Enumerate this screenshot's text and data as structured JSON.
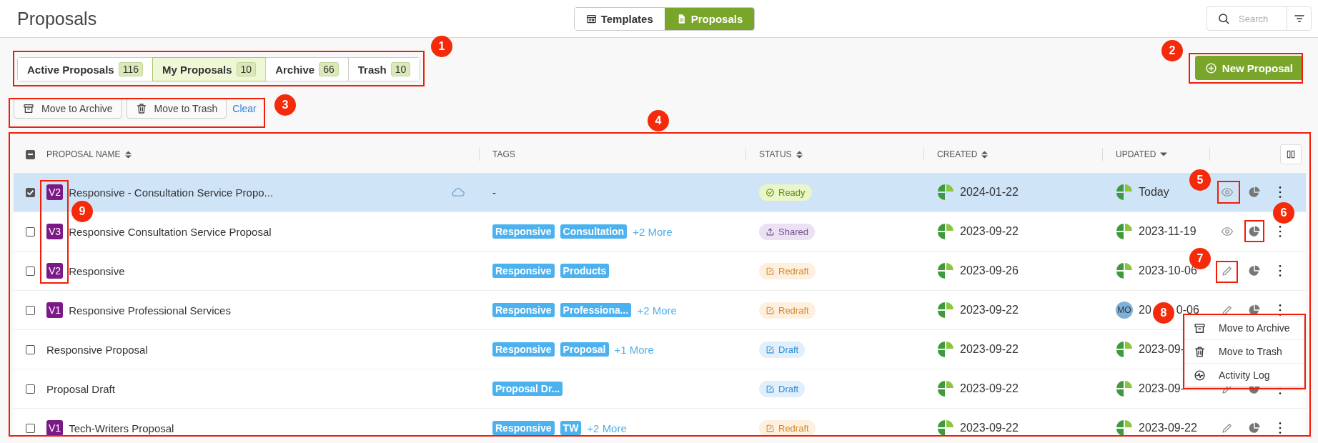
{
  "page_title": "Proposals",
  "view_switch": [
    {
      "label": "Templates",
      "selected": false
    },
    {
      "label": "Proposals",
      "selected": true
    }
  ],
  "search": {
    "placeholder": "Search"
  },
  "tabs": [
    {
      "label": "Active Proposals",
      "count": "116",
      "selected": false
    },
    {
      "label": "My Proposals",
      "count": "10",
      "selected": true
    },
    {
      "label": "Archive",
      "count": "66",
      "selected": false
    },
    {
      "label": "Trash",
      "count": "10",
      "selected": false
    }
  ],
  "new_button": "New Proposal",
  "bulk_actions": [
    {
      "label": "Move to Archive"
    },
    {
      "label": "Move to Trash"
    }
  ],
  "clear_link": "Clear",
  "table": {
    "select_all": {
      "indeterminate": true
    },
    "columns": [
      {
        "label": "PROPOSAL NAME",
        "sortable": true
      },
      {
        "label": "TAGS",
        "sortable": false
      },
      {
        "label": "STATUS",
        "sortable": true
      },
      {
        "label": "CREATED",
        "sortable": true
      },
      {
        "label": "UPDATED",
        "sortable": true,
        "sorted": true
      }
    ],
    "rows": [
      {
        "selected": true,
        "checked": true,
        "version": "V2",
        "name": "Responsive - Consultation Service Propo...",
        "cloud": true,
        "tags": [],
        "no_tags": "-",
        "status": {
          "kind": "ready",
          "label": "Ready"
        },
        "created": "2024-01-22",
        "updated": "Today",
        "updater": {
          "kind": "logo"
        },
        "action": {
          "kind": "view"
        }
      },
      {
        "selected": false,
        "checked": false,
        "version": "V3",
        "name": "Responsive Consultation Service Proposal",
        "cloud": false,
        "tags": [
          "Responsive",
          "Consultation"
        ],
        "more": "+2 More",
        "status": {
          "kind": "shared",
          "label": "Shared"
        },
        "created": "2023-09-22",
        "updated": "2023-11-19",
        "updater": {
          "kind": "logo"
        },
        "action": {
          "kind": "view"
        }
      },
      {
        "selected": false,
        "checked": false,
        "version": "V2",
        "name": "Responsive",
        "cloud": false,
        "tags": [
          "Responsive",
          "Products"
        ],
        "status": {
          "kind": "redraft",
          "label": "Redraft"
        },
        "created": "2023-09-26",
        "updated": "2023-10-06",
        "updater": {
          "kind": "logo"
        },
        "action": {
          "kind": "edit"
        }
      },
      {
        "selected": false,
        "checked": false,
        "version": "V1",
        "name": "Responsive Professional Services",
        "cloud": false,
        "tags": [
          "Responsive",
          "Professiona..."
        ],
        "more": "+2 More",
        "status": {
          "kind": "redraft",
          "label": "Redraft"
        },
        "created": "2023-09-22",
        "updated": "20",
        "updated_after_callout": "0-06",
        "updater": {
          "kind": "avatar",
          "initials": "MO"
        },
        "action": {
          "kind": "edit"
        }
      },
      {
        "selected": false,
        "checked": false,
        "name": "Responsive Proposal",
        "cloud": false,
        "tags": [
          "Responsive",
          "Proposal"
        ],
        "more": "+1 More",
        "status": {
          "kind": "draft",
          "label": "Draft"
        },
        "created": "2023-09-22",
        "updated": "2023-09-",
        "updater": {
          "kind": "logo"
        }
      },
      {
        "selected": false,
        "checked": false,
        "name": "Proposal Draft",
        "cloud": false,
        "tags": [
          "Proposal Dr..."
        ],
        "status": {
          "kind": "draft",
          "label": "Draft"
        },
        "created": "2023-09-22",
        "updated": "2023-09-",
        "updater": {
          "kind": "logo"
        },
        "action": {
          "kind": "edit"
        }
      },
      {
        "selected": false,
        "checked": false,
        "version": "V1",
        "name": "Tech-Writers Proposal",
        "cloud": false,
        "tags": [
          "Responsive",
          "TW"
        ],
        "more": "+2 More",
        "status": {
          "kind": "redraft",
          "label": "Redraft"
        },
        "created": "2023-09-22",
        "updated": "2023-09-22",
        "updater": {
          "kind": "logo"
        },
        "action": {
          "kind": "edit"
        }
      }
    ]
  },
  "row_menu": [
    {
      "label": "Move to Archive"
    },
    {
      "label": "Move to Trash"
    },
    {
      "label": "Activity Log"
    }
  ],
  "callouts": [
    "1",
    "2",
    "3",
    "4",
    "5",
    "6",
    "7",
    "8",
    "9"
  ]
}
